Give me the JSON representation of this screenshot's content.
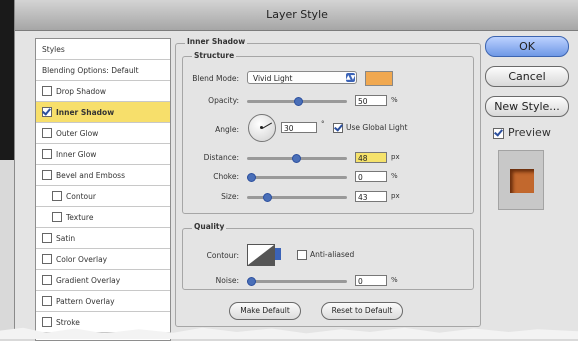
{
  "window": {
    "title": "Layer Style"
  },
  "styles": {
    "header": "Styles",
    "blending": "Blending Options: Default",
    "items": [
      {
        "label": "Drop Shadow",
        "checked": false,
        "selected": false,
        "indent": false
      },
      {
        "label": "Inner Shadow",
        "checked": true,
        "selected": true,
        "indent": false
      },
      {
        "label": "Outer Glow",
        "checked": false,
        "selected": false,
        "indent": false
      },
      {
        "label": "Inner Glow",
        "checked": false,
        "selected": false,
        "indent": false
      },
      {
        "label": "Bevel and Emboss",
        "checked": false,
        "selected": false,
        "indent": false
      },
      {
        "label": "Contour",
        "checked": false,
        "selected": false,
        "indent": true
      },
      {
        "label": "Texture",
        "checked": false,
        "selected": false,
        "indent": true
      },
      {
        "label": "Satin",
        "checked": false,
        "selected": false,
        "indent": false
      },
      {
        "label": "Color Overlay",
        "checked": false,
        "selected": false,
        "indent": false
      },
      {
        "label": "Gradient Overlay",
        "checked": false,
        "selected": false,
        "indent": false
      },
      {
        "label": "Pattern Overlay",
        "checked": false,
        "selected": false,
        "indent": false
      },
      {
        "label": "Stroke",
        "checked": false,
        "selected": false,
        "indent": false
      }
    ]
  },
  "inner_shadow": {
    "title": "Inner Shadow",
    "structure": {
      "title": "Structure",
      "blend_mode_label": "Blend Mode:",
      "blend_mode_value": "Vivid Light",
      "color": "#f0a850",
      "opacity_label": "Opacity:",
      "opacity_value": "50",
      "opacity_unit": "%",
      "opacity_level": 0.5,
      "angle_label": "Angle:",
      "angle_value": "30",
      "angle_unit": "°",
      "use_global_light": "Use Global Light",
      "use_global_light_checked": true,
      "distance_label": "Distance:",
      "distance_value": "48",
      "distance_unit": "px",
      "distance_level": 0.48,
      "choke_label": "Choke:",
      "choke_value": "0",
      "choke_unit": "%",
      "choke_level": 0,
      "size_label": "Size:",
      "size_value": "43",
      "size_unit": "px",
      "size_level": 0.17
    },
    "quality": {
      "title": "Quality",
      "contour_label": "Contour:",
      "anti_aliased": "Anti-aliased",
      "anti_aliased_checked": false,
      "noise_label": "Noise:",
      "noise_value": "0",
      "noise_unit": "%",
      "noise_level": 0
    },
    "make_default": "Make Default",
    "reset_default": "Reset to Default"
  },
  "buttons": {
    "ok": "OK",
    "cancel": "Cancel",
    "new_style": "New Style...",
    "preview": "Preview",
    "preview_checked": true
  }
}
